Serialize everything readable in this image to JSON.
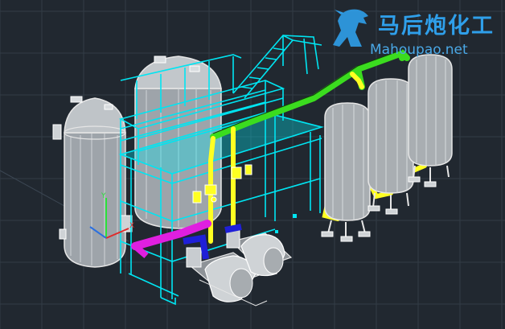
{
  "watermark": {
    "title": "马后炮化工",
    "url": "Mahoupao.net"
  },
  "colors": {
    "background": "#212830",
    "vessel": "#e6e6e6",
    "frame": "#00e5f2",
    "green_pipe": "#3bdc1f",
    "yellow_pipe": "#ffff22",
    "blue_valve": "#1f1fd8",
    "magenta_pipe": "#e01fe0",
    "axis_x": "#e02a2a",
    "axis_y": "#2ae03a",
    "axis_z": "#2a6fe0",
    "watermark": "#2f9fea"
  },
  "icons": {
    "ucs": "ucs-axis-icon",
    "logo": "horse-logo-icon"
  }
}
